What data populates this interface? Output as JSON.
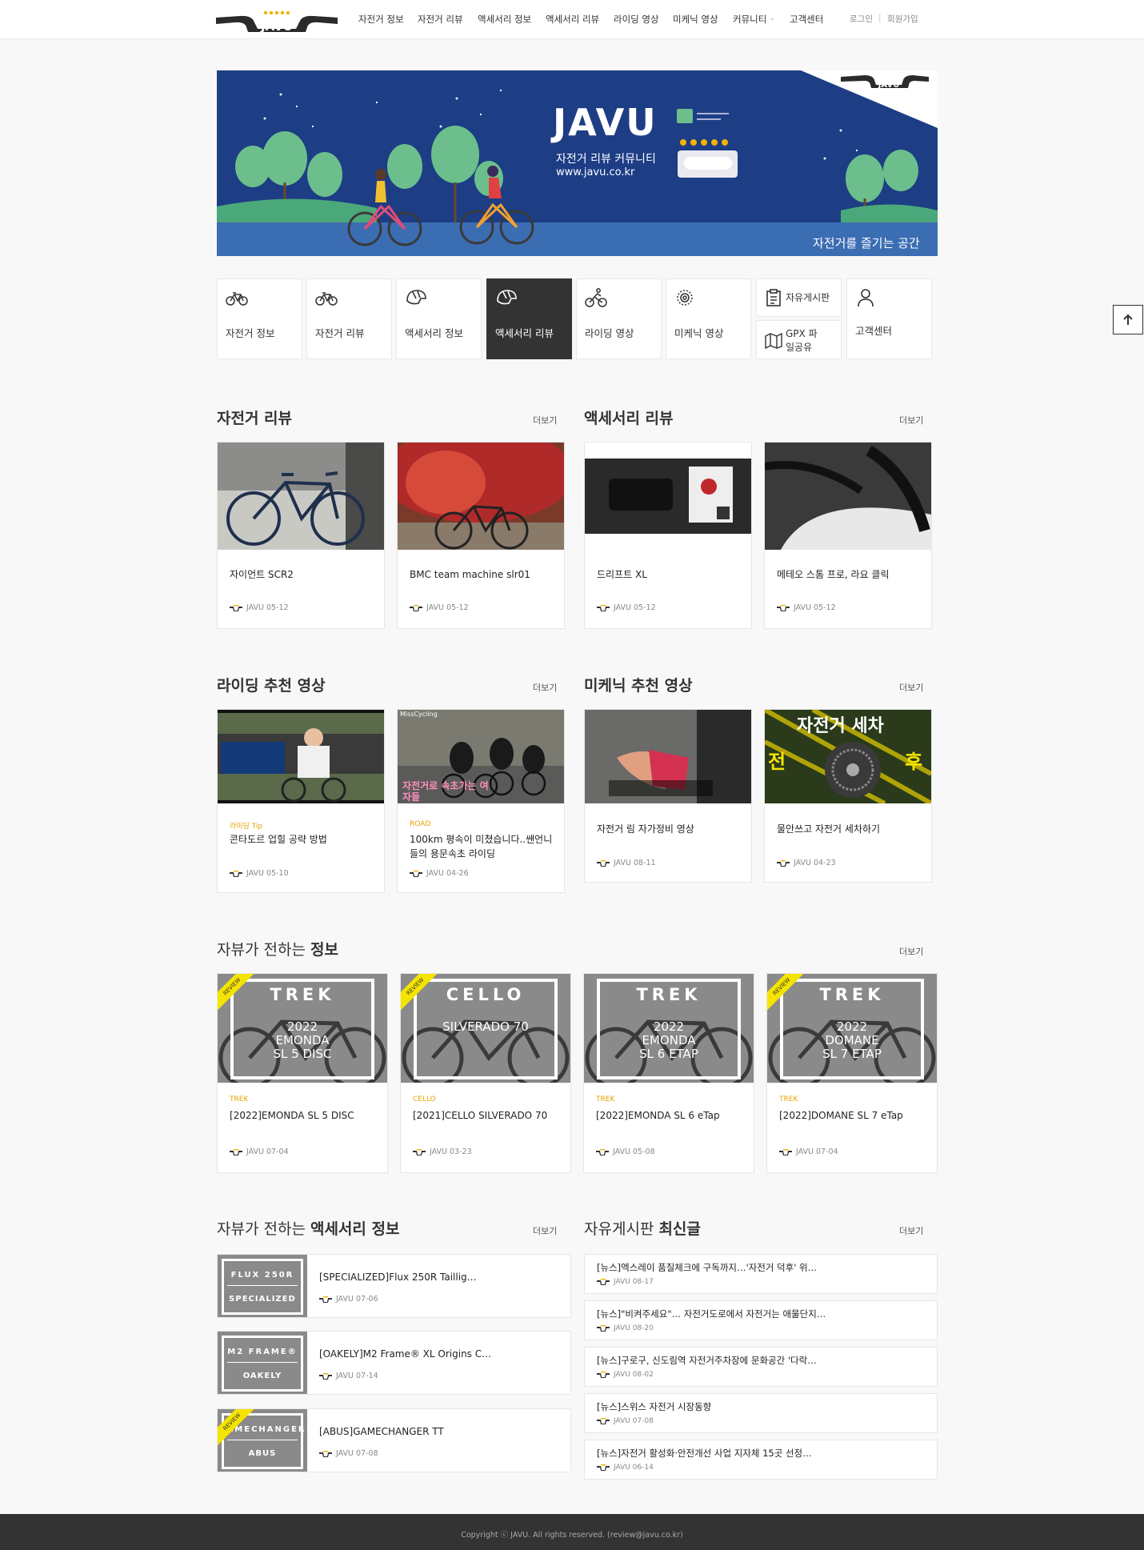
{
  "header": {
    "logo_text": "JAVU",
    "nav": [
      "자전거 정보",
      "자전거 리뷰",
      "액세서리 정보",
      "액세서리 리뷰",
      "라이딩 영상",
      "미케닉 영상",
      "커뮤니티",
      "고객센터"
    ],
    "login": "로그인",
    "signup": "회원가입"
  },
  "banner": {
    "brand": "JAVU",
    "subtitle": "자전거 리뷰 커뮤니티",
    "url": "www.javu.co.kr",
    "slogan": "자전거를 즐기는 공간",
    "colors": {
      "background": "#1d3d85",
      "tree": "#6cbf8c",
      "ground": "#3b6db3"
    }
  },
  "categories": [
    {
      "label": "자전거 정보",
      "icon": "bicycle-icon"
    },
    {
      "label": "자전거 리뷰",
      "icon": "bicycle-icon"
    },
    {
      "label": "액세서리 정보",
      "icon": "helmet-icon"
    },
    {
      "label": "액세서리 리뷰",
      "icon": "helmet-icon"
    },
    {
      "label": "라이딩 영상",
      "icon": "cyclist-icon"
    },
    {
      "label": "미케닉 영상",
      "icon": "gear-icon"
    },
    {
      "label": "자유게시판",
      "icon": "clipboard-icon"
    },
    {
      "label": "GPX 파일공유",
      "icon": "map-icon"
    },
    {
      "label": "고객센터",
      "icon": "person-icon"
    }
  ],
  "more_label": "더보기",
  "sections": {
    "bike_review": {
      "title": "자전거 리뷰",
      "cards": [
        {
          "title": "자이언트 SCR2",
          "author": "JAVU",
          "date": "05-12"
        },
        {
          "title": "BMC team machine slr01",
          "author": "JAVU",
          "date": "05-12"
        }
      ]
    },
    "acc_review": {
      "title": "액세서리 리뷰",
      "cards": [
        {
          "title": "드리프트 XL",
          "author": "JAVU",
          "date": "05-12"
        },
        {
          "title": "메테오 스톰 프로, 라요 클릭",
          "author": "JAVU",
          "date": "05-12"
        }
      ]
    },
    "riding": {
      "title": "라이딩 추천 영상",
      "cards": [
        {
          "category": "라이딩 Tip",
          "title": "콘타도르 업힐 공략 방법",
          "author": "JAVU",
          "date": "05-10"
        },
        {
          "category": "ROAD",
          "title": "100km 평속이 미쳤습니다..쌘언니들의 용문속초 라이딩",
          "author": "JAVU",
          "date": "04-26",
          "image_caption": "자전거로 속초가는 여자들",
          "channel": "MissCycling"
        }
      ]
    },
    "mechanic": {
      "title": "미케닉 추천 영상",
      "cards": [
        {
          "title": "자전거 림 자가정비 영상",
          "author": "JAVU",
          "date": "08-11"
        },
        {
          "title": "물안쓰고 자전거 세차하기",
          "author": "JAVU",
          "date": "04-23",
          "image_caption": "자전거 세차",
          "before": "전",
          "after": "후"
        }
      ]
    },
    "info": {
      "title_pre": "자뷰가 전하는 ",
      "title_bold": "정보",
      "cards": [
        {
          "brand": "TREK",
          "poster": [
            "TREK",
            "2022",
            "EMONDA",
            "SL 5 DISC"
          ],
          "review": true,
          "title": "[2022]EMONDA SL 5 DISC",
          "author": "JAVU",
          "date": "07-04"
        },
        {
          "brand": "CELLO",
          "poster": [
            "CELLO",
            "",
            "SILVERADO 70",
            ""
          ],
          "review": true,
          "title": "[2021]CELLO SILVERADO 70",
          "author": "JAVU",
          "date": "03-23"
        },
        {
          "brand": "TREK",
          "poster": [
            "TREK",
            "2022",
            "EMONDA",
            "SL 6 ETAP"
          ],
          "review": false,
          "title": "[2022]EMONDA SL 6 eTap",
          "author": "JAVU",
          "date": "05-08"
        },
        {
          "brand": "TREK",
          "poster": [
            "TREK",
            "2022",
            "DOMANE",
            "SL 7 ETAP"
          ],
          "review": true,
          "title": "[2022]DOMANE SL 7 eTap",
          "author": "JAVU",
          "date": "07-04"
        }
      ]
    },
    "acc_info": {
      "title_pre": "자뷰가 전하는 ",
      "title_bold": "액세서리 정보",
      "items": [
        {
          "poster": [
            "FLUX 250R",
            "SPECIALIZED"
          ],
          "review": false,
          "title": "[SPECIALIZED]Flux 250R Taillig…",
          "author": "JAVU",
          "date": "07-06"
        },
        {
          "poster": [
            "M2 FRAME®",
            "OAKELY"
          ],
          "review": false,
          "title": "[OAKELY]M2 Frame® XL Origins C…",
          "author": "JAVU",
          "date": "07-14"
        },
        {
          "poster": [
            "GAMECHANGER",
            "ABUS"
          ],
          "review": true,
          "title": "[ABUS]GAMECHANGER TT",
          "author": "JAVU",
          "date": "07-08"
        }
      ]
    },
    "board": {
      "title_pre": "자유게시판 ",
      "title_bold": "최신글",
      "posts": [
        {
          "title": "[뉴스]엑스레이 품질체크에 구독까지…'자전거 덕후' 위…",
          "author": "JAVU",
          "date": "08-17"
        },
        {
          "title": "[뉴스]\"비켜주세요\"… 자전거도로에서 자전거는 애물단지…",
          "author": "JAVU",
          "date": "08-20"
        },
        {
          "title": "[뉴스]구로구, 신도림역 자전거주차장에 문화공간 '다락…",
          "author": "JAVU",
          "date": "08-02"
        },
        {
          "title": "[뉴스]스위스 자전거 시장동향",
          "author": "JAVU",
          "date": "07-08"
        },
        {
          "title": "[뉴스]자전거 활성화·안전개선 사업 지자체 15곳 선정…",
          "author": "JAVU",
          "date": "06-14"
        }
      ]
    }
  },
  "review_badge": "REVIEW",
  "footer": {
    "copyright": "Copyright ⓒ JAVU. All rights reserved. (review@javu.co.kr)"
  },
  "colors": {
    "accent": "#e8a200",
    "dark": "#333333",
    "badge": "#f5e400"
  }
}
